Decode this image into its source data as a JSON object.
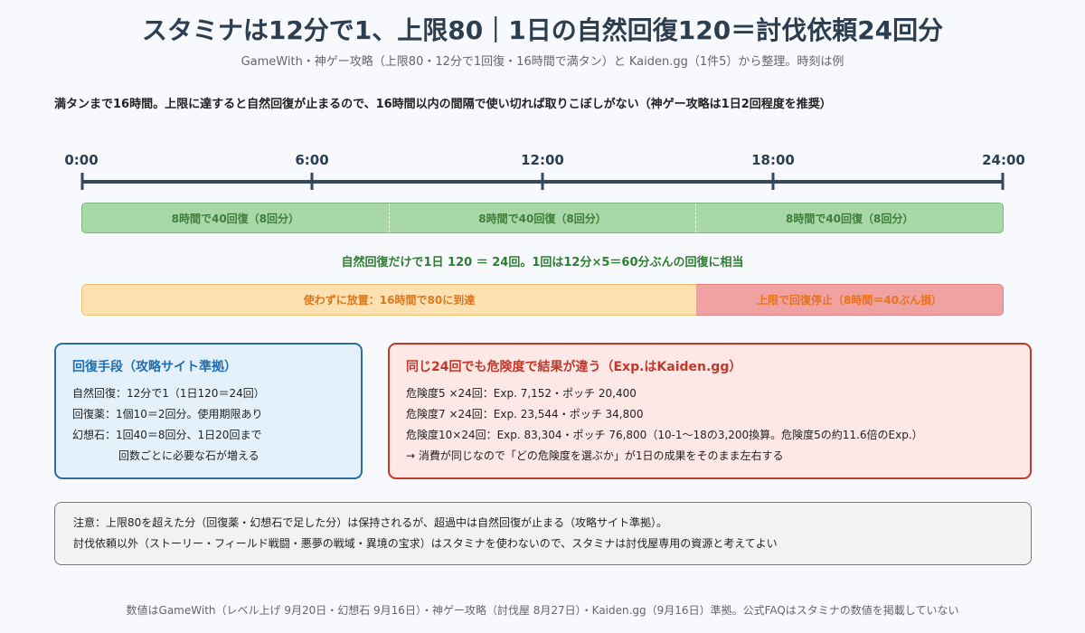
{
  "header": {
    "title": "スタミナは12分で1、上限80｜1日の自然回復120＝討伐依頼24回分",
    "subtitle": "GameWith・神ゲー攻略（上限80・12分で1回復・16時間で満タン）と Kaiden.gg（1件5）から整理。時刻は例"
  },
  "summary": "満タンまで16時間。上限に達すると自然回復が止まるので、16時間以内の間隔で使い切れば取りこぼしがない（神ゲー攻略は1日2回程度を推奨）",
  "timeline": {
    "ticks": [
      "0:00",
      "6:00",
      "12:00",
      "18:00",
      "24:00"
    ],
    "green_segments": [
      "8時間で40回復（8回分）",
      "8時間で40回復（8回分）",
      "8時間で40回復（8回分）"
    ],
    "green_caption": "自然回復だけで1日 120 ＝ 24回。1回は12分×5＝60分ぶんの回復に相当",
    "idle_label": "使わずに放置：16時間で80に到達",
    "stop_label": "上限で回復停止（8時間＝40ぶん損）"
  },
  "recovery_card": {
    "title": "回復手段（攻略サイト準拠）",
    "lines": [
      "自然回復：12分で1（1日120＝24回）",
      "回復薬：1個10＝2回分。使用期限あり",
      "幻想石：1回40＝8回分、1日20回まで",
      "回数ごとに必要な石が増える"
    ]
  },
  "danger_card": {
    "title": "同じ24回でも危険度で結果が違う（Exp.はKaiden.gg）",
    "lines": [
      "危険度5 ×24回：Exp. 7,152・ポッチ 20,400",
      "危険度7 ×24回：Exp. 23,544・ポッチ 34,800",
      "危険度10×24回：Exp. 83,304・ポッチ 76,800（10-1〜18の3,200換算。危険度5の約11.6倍のExp.）",
      "→ 消費が同じなので「どの危険度を選ぶか」が1日の成果をそのまま左右する"
    ]
  },
  "notes": {
    "lines": [
      "注意：上限80を超えた分（回復薬・幻想石で足した分）は保持されるが、超過中は自然回復が止まる（攻略サイト準拠）。",
      "討伐依頼以外（ストーリー・フィールド戦闘・悪夢の戦域・異境の宝求）はスタミナを使わないので、スタミナは討伐屋専用の資源と考えてよい"
    ]
  },
  "footer": "数値はGameWith（レベル上げ 9月20日・幻想石 9月16日）・神ゲー攻略（討伐屋 8月27日）・Kaiden.gg（9月16日）準拠。公式FAQはスタミナの数値を掲載していない",
  "colors": {
    "accent_blue": "#2c6e9e",
    "accent_red": "#c0392b",
    "recovery_green": "#a9d8a8",
    "idle_orange": "#fde1b3",
    "stop_red": "#f0a2a2"
  }
}
